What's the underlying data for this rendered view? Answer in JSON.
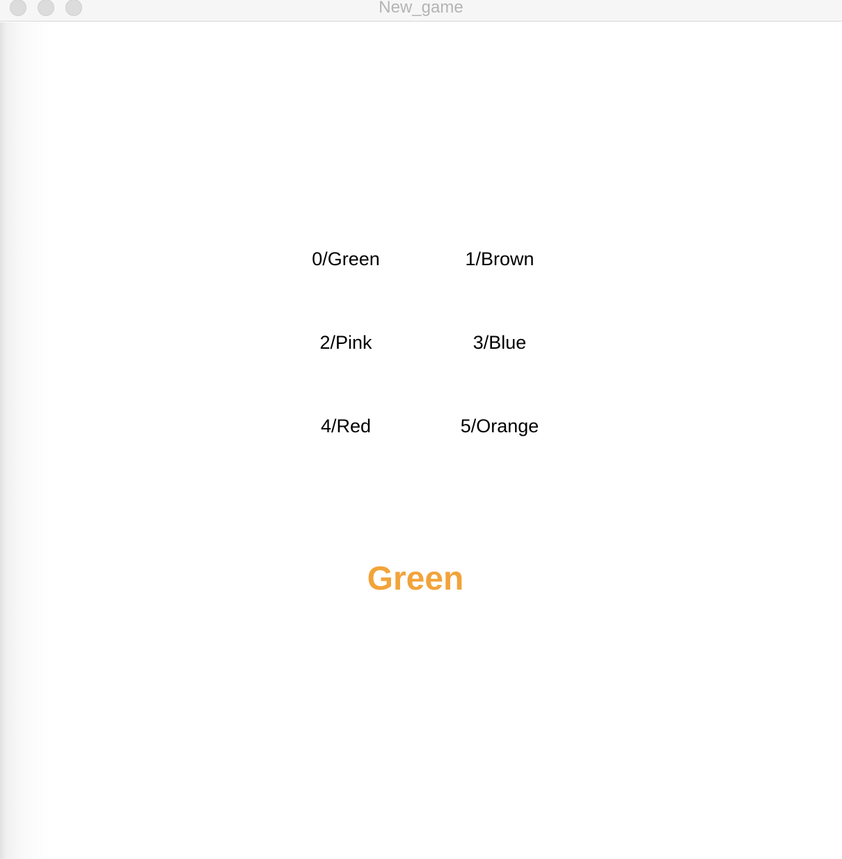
{
  "window": {
    "title": "New_game"
  },
  "options": [
    {
      "label": "0/Green"
    },
    {
      "label": "1/Brown"
    },
    {
      "label": "2/Pink"
    },
    {
      "label": "3/Blue"
    },
    {
      "label": "4/Red"
    },
    {
      "label": "5/Orange"
    }
  ],
  "target": {
    "word": "Green",
    "color": "#f2a33a"
  },
  "colors": {
    "option_text": "#000000",
    "titlebar_text": "#b4b4b4",
    "background": "#ffffff"
  }
}
